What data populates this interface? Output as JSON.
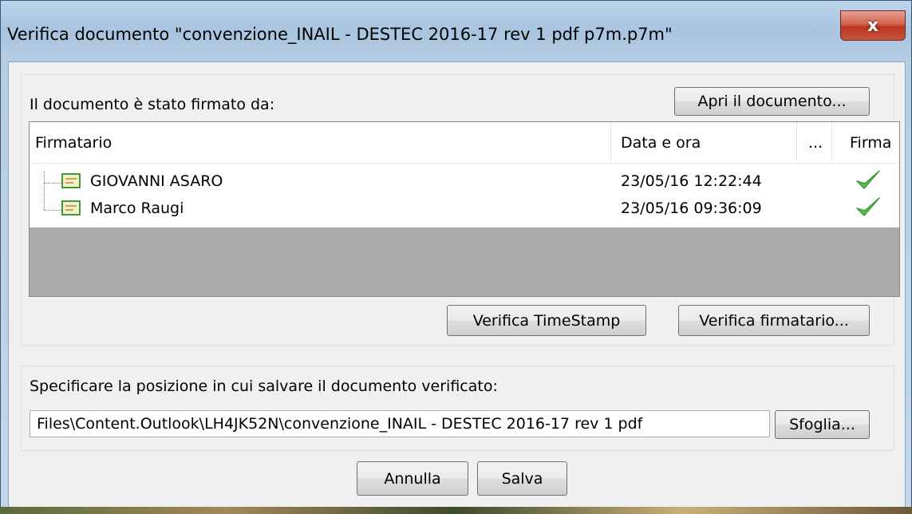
{
  "window": {
    "title": "Verifica documento \"convenzione_INAIL - DESTEC 2016-17 rev  1 pdf p7m.p7m\"",
    "close_label": "x"
  },
  "signers_group": {
    "heading": "Il documento è stato firmato da:",
    "open_button": "Apri il documento...",
    "columns": [
      "Firmatario",
      "Data e ora",
      "...",
      "Firma"
    ],
    "rows": [
      {
        "signer": "GIOVANNI ASARO",
        "datetime": "23/05/16 12:22:44",
        "signature_status": "valid-check-icon"
      },
      {
        "signer": "Marco Raugi",
        "datetime": "23/05/16 09:36:09",
        "signature_status": "valid-check-icon"
      }
    ],
    "timestamp_button": "Verifica TimeStamp",
    "verify_signer_button": "Verifica firmatario..."
  },
  "save_group": {
    "heading": "Specificare la posizione in cui salvare il documento verificato:",
    "path_value": "Files\\Content.Outlook\\LH4JK52N\\convenzione_INAIL - DESTEC 2016-17 rev  1 pdf",
    "browse_button": "Sfoglia..."
  },
  "footer": {
    "cancel_button": "Annulla",
    "save_button": "Salva"
  },
  "colors": {
    "check_green": "#5cc34a",
    "cert_border": "#3f9a3a",
    "list_empty_bg": "#ababab"
  }
}
